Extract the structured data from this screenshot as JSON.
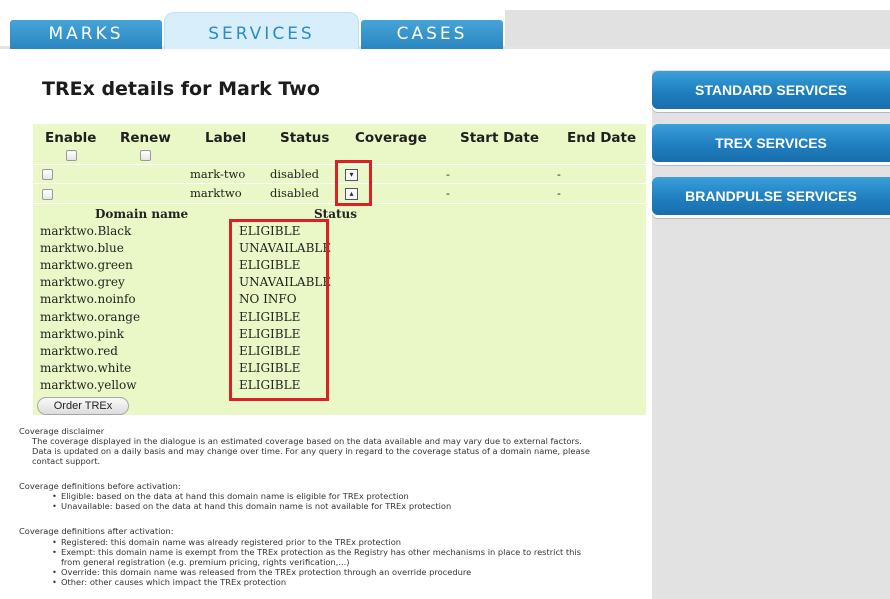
{
  "tabs": [
    {
      "label": "MARKS"
    },
    {
      "label": "SERVICES"
    },
    {
      "label": "CASES"
    }
  ],
  "side_menu": [
    {
      "label": "STANDARD SERVICES"
    },
    {
      "label": "TREX SERVICES"
    },
    {
      "label": "BRANDPULSE SERVICES"
    }
  ],
  "page_title": "TREx details for Mark Two",
  "table": {
    "headers": {
      "enable": "Enable",
      "renew": "Renew",
      "label": "Label",
      "status": "Status",
      "coverage": "Coverage",
      "start_date": "Start Date",
      "end_date": "End Date"
    },
    "rows": [
      {
        "label": "mark-two",
        "status": "disabled",
        "coverage_icon": "download-icon",
        "start_date": "-",
        "end_date": "-"
      },
      {
        "label": "marktwo",
        "status": "disabled",
        "coverage_icon": "upload-icon",
        "start_date": "-",
        "end_date": "-"
      }
    ]
  },
  "domains": {
    "header_name": "Domain name",
    "header_status": "Status",
    "items": [
      {
        "name": "marktwo.Black",
        "status": "ELIGIBLE"
      },
      {
        "name": "marktwo.blue",
        "status": "UNAVAILABLE"
      },
      {
        "name": "marktwo.green",
        "status": "ELIGIBLE"
      },
      {
        "name": "marktwo.grey",
        "status": "UNAVAILABLE"
      },
      {
        "name": "marktwo.noinfo",
        "status": "NO INFO"
      },
      {
        "name": "marktwo.orange",
        "status": "ELIGIBLE"
      },
      {
        "name": "marktwo.pink",
        "status": "ELIGIBLE"
      },
      {
        "name": "marktwo.red",
        "status": "ELIGIBLE"
      },
      {
        "name": "marktwo.white",
        "status": "ELIGIBLE"
      },
      {
        "name": "marktwo.yellow",
        "status": "ELIGIBLE"
      }
    ]
  },
  "order_button": "Order TREx",
  "disclaimer": {
    "title": "Coverage disclaimer",
    "lines": [
      "The coverage displayed in the dialogue is an estimated coverage based on the data available and may vary due to external factors.",
      "Data is updated on a daily basis and may change over time. For any query in regard to the coverage status of a domain name, please",
      "contact support."
    ]
  },
  "definitions_before": {
    "title": "Coverage definitions before activation:",
    "items": [
      "Eligible: based on the data at hand this domain name is eligible for TREx protection",
      "Unavailable: based on the data at hand this domain name is not available for TREx protection"
    ]
  },
  "definitions_after": {
    "title": "Coverage definitions after activation:",
    "items": [
      "Registered: this domain name was already registered prior to the TREx protection",
      "Exempt: this domain name is exempt from the TREx protection as the Registry has other mechanisms in place to restrict this",
      "from general registration (e.g. premium pricing, rights verification,...)",
      "Override: this domain name was released from the TREx protection through an override procedure",
      "Other: other causes which impact the TREx protection"
    ]
  },
  "colors": {
    "tab_blue": "#2a86c0",
    "panel_green": "#eaf7c6",
    "highlight_red": "#dd1f26",
    "side_grey": "#e2e2e2"
  }
}
